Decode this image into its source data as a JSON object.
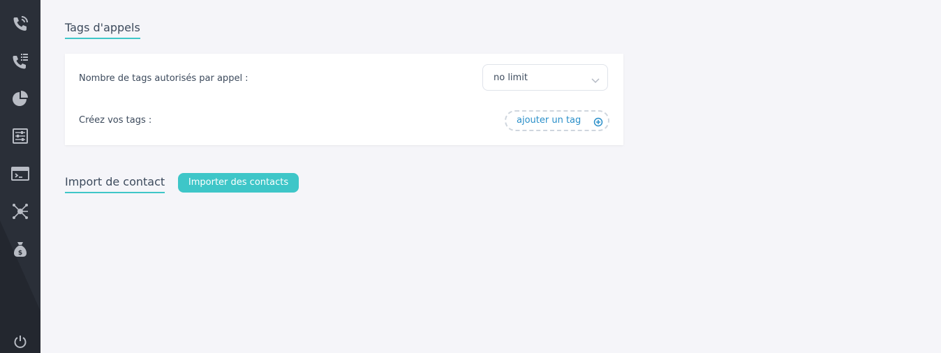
{
  "sidebar": {
    "items": [
      {
        "name": "phone-calls-icon"
      },
      {
        "name": "call-list-icon"
      },
      {
        "name": "pie-chart-icon"
      },
      {
        "name": "settings-sliders-icon"
      },
      {
        "name": "terminal-window-icon"
      },
      {
        "name": "network-icon"
      },
      {
        "name": "money-bag-icon"
      }
    ],
    "power_icon": "power-icon"
  },
  "tags_section": {
    "title": "Tags d'appels",
    "limit_label": "Nombre de tags autorisés par appel :",
    "limit_value": "no limit",
    "create_label": "Créez vos tags :",
    "add_tag_label": "ajouter un tag"
  },
  "import_section": {
    "title": "Import de contact",
    "button_label": "Importer des contacts"
  },
  "colors": {
    "accent": "#3ec6c8",
    "link": "#2a8fc9",
    "sidebar": "#2a2f38",
    "background": "#f5f5f9"
  }
}
